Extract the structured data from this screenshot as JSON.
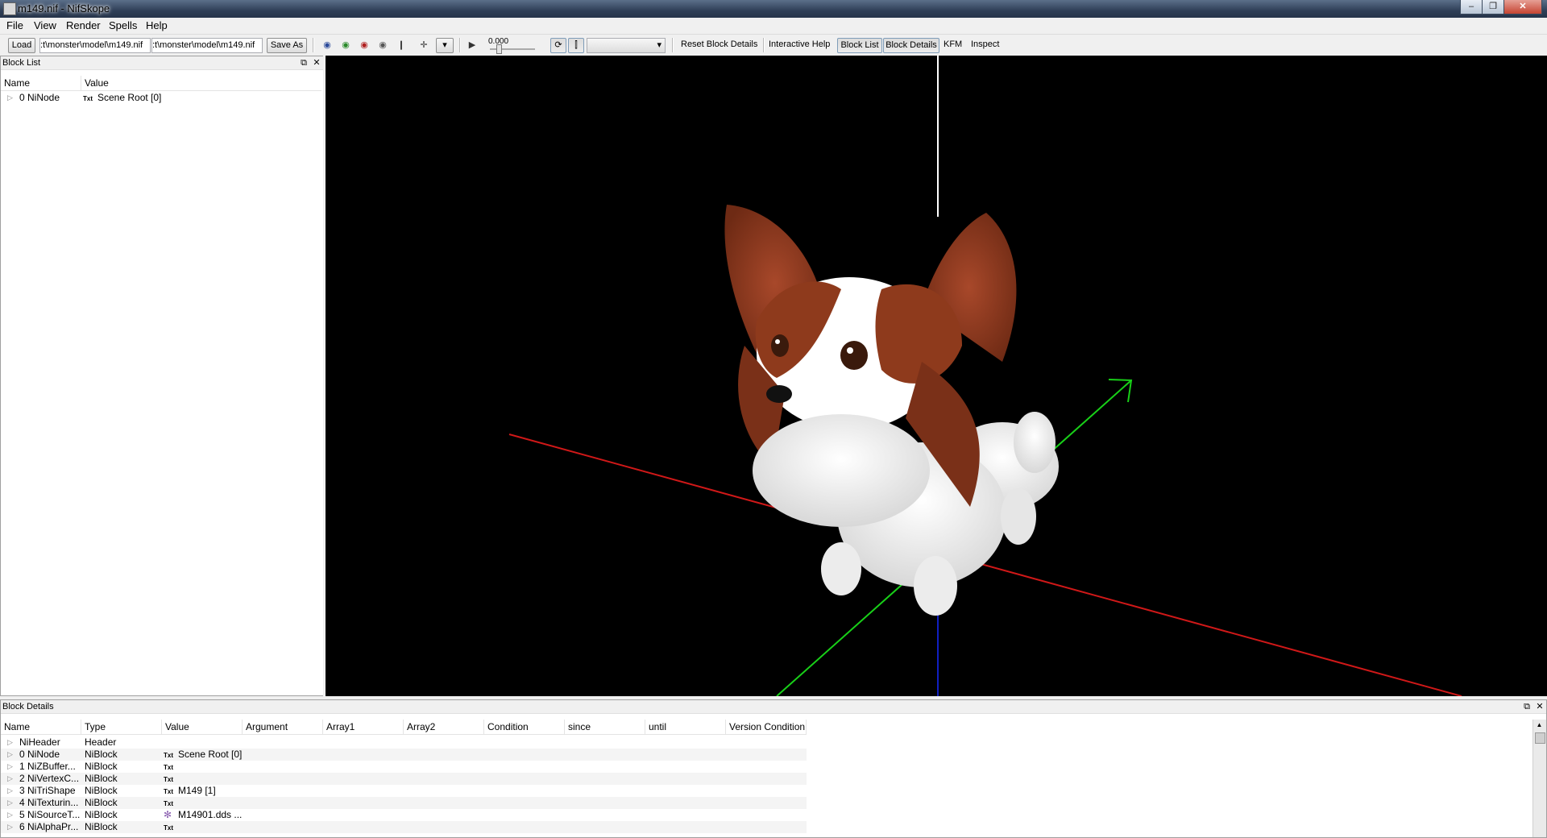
{
  "window": {
    "title": "m149.nif - NifSkope",
    "min": "–",
    "restore": "❐",
    "close": "✕"
  },
  "menu": [
    "File",
    "View",
    "Render",
    "Spells",
    "Help"
  ],
  "toolbar": {
    "load_label": "Load",
    "load_path": ":t\\monster\\model\\m149.nif",
    "save_path": ":t\\monster\\model\\m149.nif",
    "save_as_label": "Save As",
    "time_value": "0.000",
    "reset_label": "Reset Block Details",
    "help_label": "Interactive Help",
    "block_list_label": "Block List",
    "block_details_label": "Block Details",
    "kfm_label": "KFM",
    "inspect_label": "Inspect"
  },
  "block_list": {
    "title": "Block List",
    "columns": [
      "Name",
      "Value"
    ],
    "rows": [
      {
        "name": "0 NiNode",
        "icon": "Txt",
        "value": "Scene Root [0]"
      }
    ]
  },
  "block_details": {
    "title": "Block Details",
    "columns": [
      "Name",
      "Type",
      "Value",
      "Argument",
      "Array1",
      "Array2",
      "Condition",
      "since",
      "until",
      "Version Condition"
    ],
    "rows": [
      {
        "name": "NiHeader",
        "type": "Header",
        "icon": "",
        "value": ""
      },
      {
        "name": "0 NiNode",
        "type": "NiBlock",
        "icon": "Txt",
        "value": "Scene Root [0]"
      },
      {
        "name": "1 NiZBuffer...",
        "type": "NiBlock",
        "icon": "Txt",
        "value": ""
      },
      {
        "name": "2 NiVertexC...",
        "type": "NiBlock",
        "icon": "Txt",
        "value": ""
      },
      {
        "name": "3 NiTriShape",
        "type": "NiBlock",
        "icon": "Txt",
        "value": "M149 [1]"
      },
      {
        "name": "4 NiTexturin...",
        "type": "NiBlock",
        "icon": "Txt",
        "value": ""
      },
      {
        "name": "5 NiSourceT...",
        "type": "NiBlock",
        "icon": "✻",
        "value": "M14901.dds ..."
      },
      {
        "name": "6 NiAlphaPr...",
        "type": "NiBlock",
        "icon": "Txt",
        "value": ""
      }
    ]
  },
  "colors": {
    "x_axis": "#d01818",
    "y_axis": "#18d018",
    "z_axis": "#1020c0",
    "fur_brown": "#8e3a1c",
    "fur_white": "#f4f4f4"
  }
}
